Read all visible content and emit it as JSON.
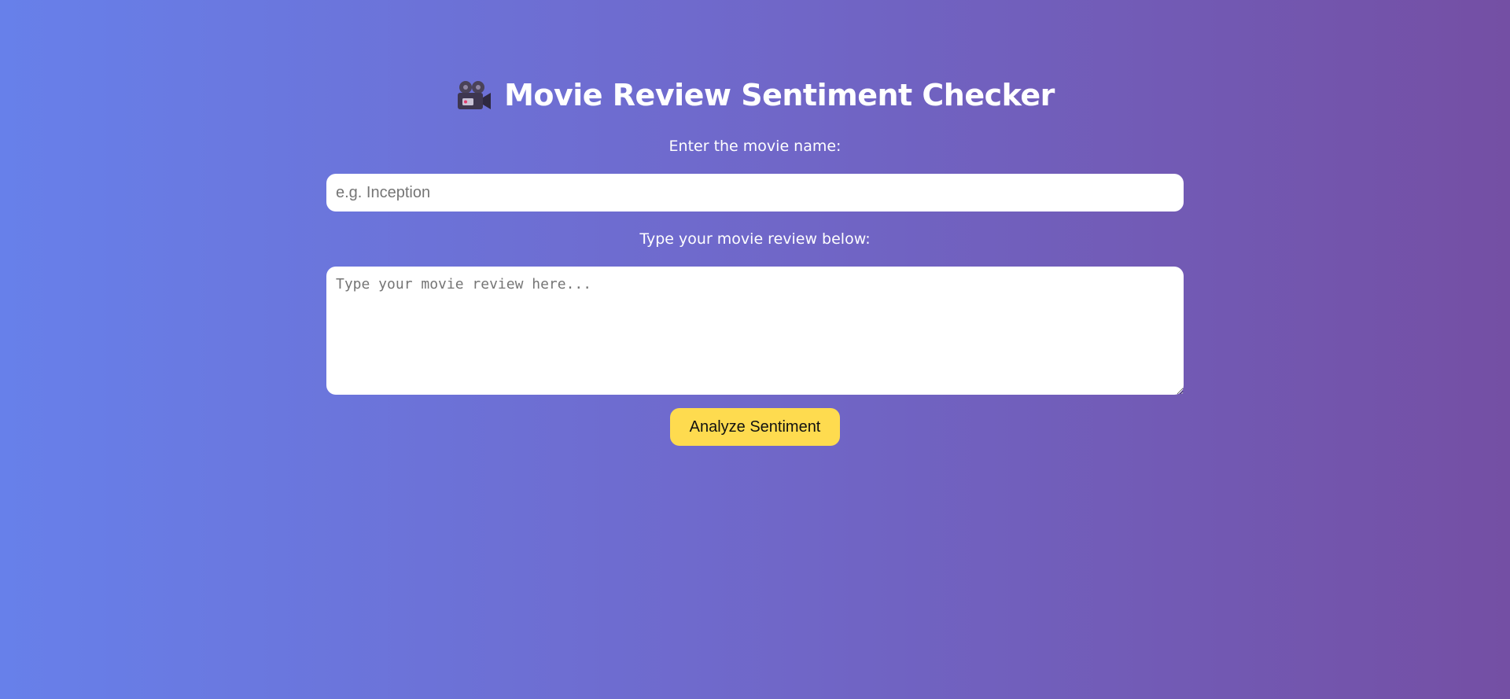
{
  "header": {
    "icon": "movie-camera-icon",
    "title": "Movie Review Sentiment Checker"
  },
  "form": {
    "movie_label": "Enter the movie name:",
    "movie_placeholder": "e.g. Inception",
    "movie_value": "",
    "review_label": "Type your movie review below:",
    "review_placeholder": "Type your movie review here...",
    "review_value": "",
    "submit_label": "Analyze Sentiment"
  },
  "colors": {
    "gradient_start": "#6780ea",
    "gradient_end": "#744fa4",
    "button": "#fedb4f"
  }
}
